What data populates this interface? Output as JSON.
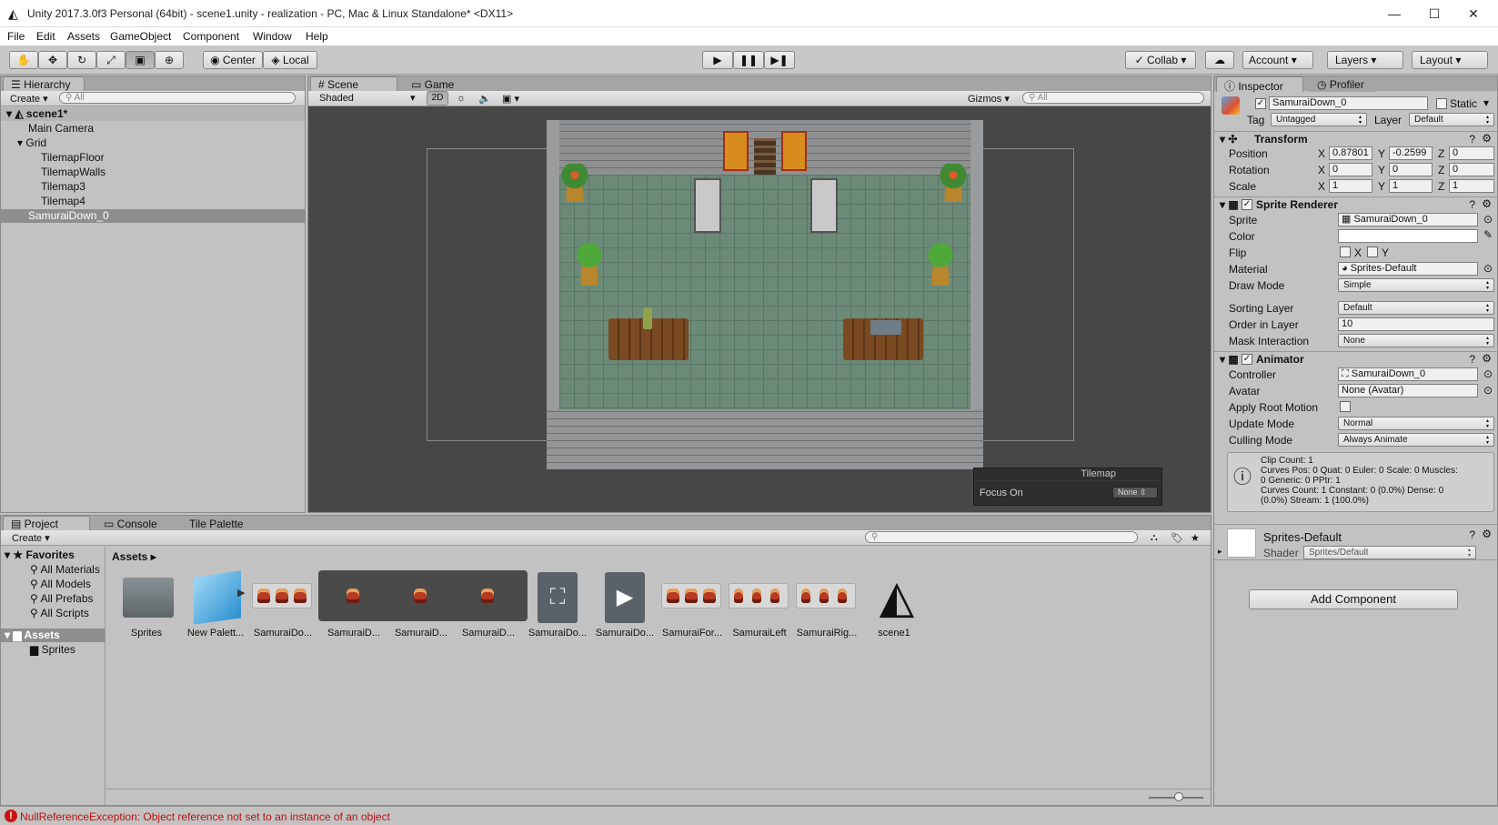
{
  "window": {
    "title": "Unity 2017.3.0f3 Personal (64bit) - scene1.unity - realization - PC, Mac & Linux Standalone* <DX11>",
    "minimize": "—",
    "maximize": "☐",
    "close": "✕"
  },
  "menu": [
    "File",
    "Edit",
    "Assets",
    "GameObject",
    "Component",
    "Window",
    "Help"
  ],
  "toolbar": {
    "pivot": "Center",
    "space": "Local",
    "collab": "Collab ▾",
    "account": "Account",
    "layers": "Layers",
    "layout": "Layout"
  },
  "hierarchy": {
    "tab": "Hierarchy",
    "create": "Create ▾",
    "search_placeholder": "All",
    "scene": "scene1*",
    "items": [
      "Main Camera",
      "Grid",
      "TilemapFloor",
      "TilemapWalls",
      "Tilemap3",
      "Tilemap4",
      "SamuraiDown_0"
    ]
  },
  "scene": {
    "tab_scene": "Scene",
    "tab_game": "Game",
    "shading": "Shaded",
    "mode_2d": "2D",
    "gizmos": "Gizmos",
    "search_placeholder": "All",
    "overlay_title": "Tilemap",
    "focus_label": "Focus On",
    "focus_value": "None"
  },
  "inspector": {
    "tab": "Inspector",
    "tab_profiler": "Profiler",
    "object_name": "SamuraiDown_0",
    "static_label": "Static",
    "tag_label": "Tag",
    "tag_value": "Untagged",
    "layer_label": "Layer",
    "layer_value": "Default",
    "transform": {
      "title": "Transform",
      "position_label": "Position",
      "rotation_label": "Rotation",
      "scale_label": "Scale",
      "position": [
        "0.87801",
        "-0.2599",
        "0"
      ],
      "rotation": [
        "0",
        "0",
        "0"
      ],
      "scale": [
        "1",
        "1",
        "1"
      ],
      "x": "X",
      "y": "Y",
      "z": "Z"
    },
    "sprite_renderer": {
      "title": "Sprite Renderer",
      "sprite_label": "Sprite",
      "sprite_value": "SamuraiDown_0",
      "color_label": "Color",
      "flip_label": "Flip",
      "flip_x": "X",
      "flip_y": "Y",
      "material_label": "Material",
      "material_value": "Sprites-Default",
      "draw_mode_label": "Draw Mode",
      "draw_mode_value": "Simple",
      "sorting_layer_label": "Sorting Layer",
      "sorting_layer_value": "Default",
      "order_label": "Order in Layer",
      "order_value": "10",
      "mask_label": "Mask Interaction",
      "mask_value": "None"
    },
    "animator": {
      "title": "Animator",
      "controller_label": "Controller",
      "controller_value": "SamuraiDown_0",
      "avatar_label": "Avatar",
      "avatar_value": "None (Avatar)",
      "root_motion_label": "Apply Root Motion",
      "update_label": "Update Mode",
      "update_value": "Normal",
      "culling_label": "Culling Mode",
      "culling_value": "Always Animate",
      "info": [
        "Clip Count: 1",
        "Curves Pos: 0 Quat: 0 Euler: 0 Scale: 0 Muscles:",
        "0 Generic: 0 PPtr: 1",
        "Curves Count: 1 Constant: 0 (0.0%) Dense: 0",
        "(0.0%) Stream: 1 (100.0%)"
      ]
    },
    "material": {
      "name": "Sprites-Default",
      "shader_label": "Shader",
      "shader_value": "Sprites/Default"
    },
    "add_component": "Add Component"
  },
  "project": {
    "tab_project": "Project",
    "tab_console": "Console",
    "tab_palette": "Tile Palette",
    "create": "Create ▾",
    "favorites": "Favorites",
    "fav_items": [
      "All Materials",
      "All Models",
      "All Prefabs",
      "All Scripts"
    ],
    "assets_root": "Assets",
    "assets_children": [
      "Sprites"
    ],
    "breadcrumb": "Assets ▸",
    "assets": [
      "Sprites",
      "New Palett...",
      "SamuraiDo...",
      "SamuraiD...",
      "SamuraiD...",
      "SamuraiD...",
      "SamuraiDo...",
      "SamuraiDo...",
      "SamuraiFor...",
      "SamuraiLeft",
      "SamuraiRig...",
      "scene1"
    ]
  },
  "status": {
    "error": "NullReferenceException: Object reference not set to an instance of an object",
    "error_color": "#d01010"
  }
}
